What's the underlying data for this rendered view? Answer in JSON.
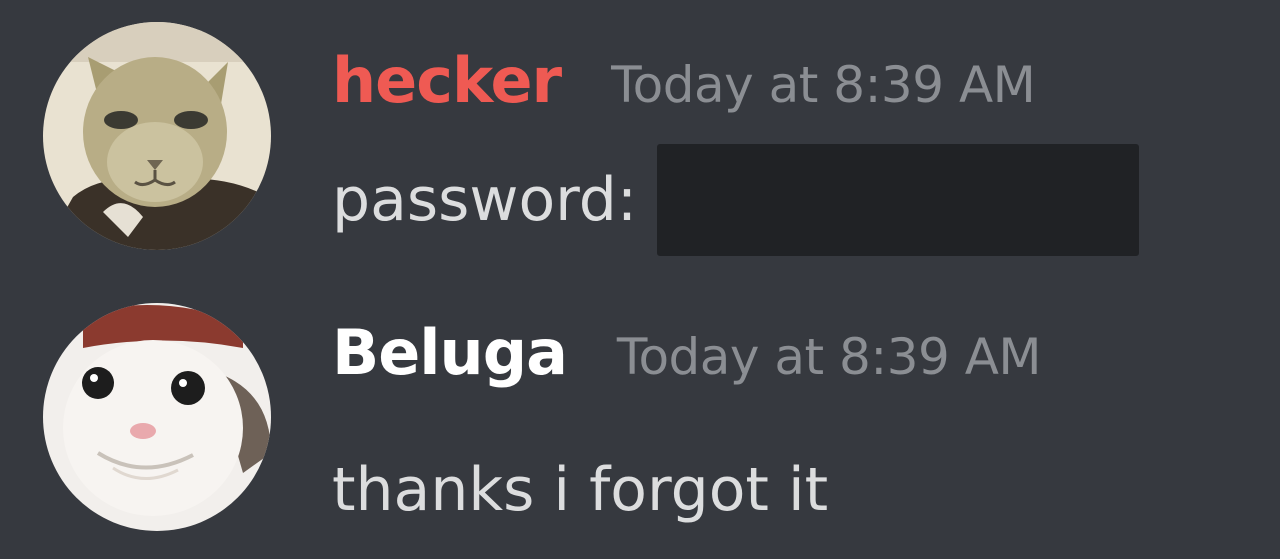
{
  "messages": [
    {
      "username": "hecker",
      "username_color": "#ef5a53",
      "timestamp": "Today at 8:39 AM",
      "text": "password:",
      "spoiler": "",
      "avatar_icon": "cat-avatar"
    },
    {
      "username": "Beluga",
      "username_color": "#ffffff",
      "timestamp": "Today at 8:39 AM",
      "text": "thanks i forgot it",
      "avatar_icon": "beluga-cat-avatar"
    }
  ]
}
